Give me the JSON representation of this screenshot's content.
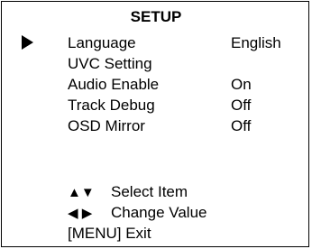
{
  "osd": {
    "title": "SETUP",
    "cursor_icon": "right-triangle-icon",
    "items": [
      {
        "label": "Language",
        "value": "English",
        "selected": true
      },
      {
        "label": "UVC Setting",
        "value": ""
      },
      {
        "label": "Audio Enable",
        "value": "On"
      },
      {
        "label": "Track Debug",
        "value": "Off"
      },
      {
        "label": "OSD Mirror",
        "value": "Off"
      }
    ],
    "hints": {
      "select": {
        "icons": "▲▼",
        "icon_names": [
          "up-triangle-icon",
          "down-triangle-icon"
        ],
        "text": "Select Item"
      },
      "change": {
        "icons": "◀ ▶",
        "icon_names": [
          "left-triangle-icon",
          "right-triangle-icon"
        ],
        "text": "Change Value"
      },
      "exit": {
        "text": "[MENU] Exit"
      }
    }
  }
}
